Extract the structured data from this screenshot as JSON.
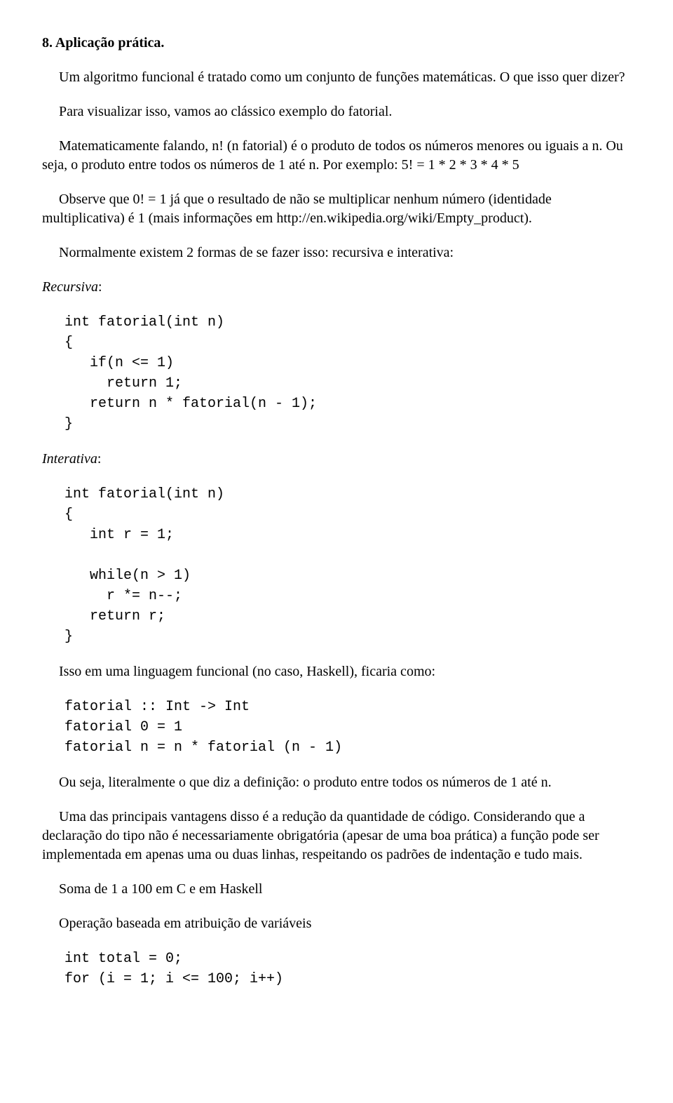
{
  "section": {
    "heading": "8. Aplicação prática."
  },
  "paragraphs": {
    "p1": "Um algoritmo funcional é tratado como um conjunto de funções matemáticas. O que isso quer dizer?",
    "p2": "Para visualizar isso, vamos ao clássico exemplo do fatorial.",
    "p3": "Matematicamente falando, n! (n fatorial) é o produto de todos os números menores ou iguais a n. Ou seja, o produto entre todos os números de 1 até n. Por exemplo: 5! = 1 * 2 * 3 * 4 * 5",
    "p4": "Observe que 0! = 1 já que o resultado de não se multiplicar nenhum número (identidade multiplicativa) é 1 (mais informações em http://en.wikipedia.org/wiki/Empty_product).",
    "p5": "Normalmente existem 2 formas de se fazer isso: recursiva e interativa:",
    "label_recursiva": "Recursiva",
    "label_interativa": "Interativa",
    "p6": "Isso em uma linguagem funcional (no caso, Haskell), ficaria como:",
    "p7": "Ou seja, literalmente o que diz a definição: o produto entre todos os números de 1 até n.",
    "p8": "Uma das principais vantagens disso é a redução da quantidade de código. Considerando que a declaração do tipo não é necessariamente obrigatória (apesar de uma boa prática) a função pode ser implementada em apenas uma ou duas linhas, respeitando os padrões de indentação e tudo mais.",
    "p9": "Soma de 1 a 100 em C e em Haskell",
    "p10": "Operação baseada em atribuição de variáveis"
  },
  "code": {
    "recursiva": "int fatorial(int n)\n{\n   if(n <= 1)\n     return 1;\n   return n * fatorial(n - 1);\n}",
    "interativa": "int fatorial(int n)\n{\n   int r = 1;\n\n   while(n > 1)\n     r *= n--;\n   return r;\n}",
    "haskell": "fatorial :: Int -> Int\nfatorial 0 = 1\nfatorial n = n * fatorial (n - 1)",
    "soma_c": "int total = 0;\nfor (i = 1; i <= 100; i++)"
  }
}
